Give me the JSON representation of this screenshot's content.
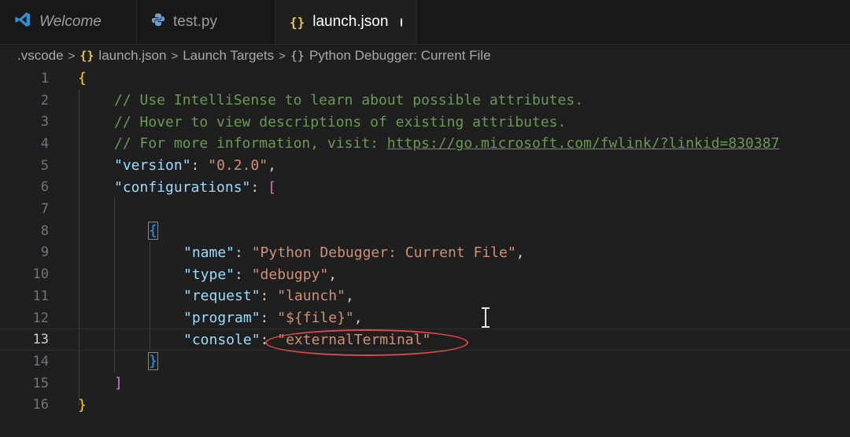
{
  "tabs": [
    {
      "label": "Welcome",
      "icon": "vscode-logo-icon"
    },
    {
      "label": "test.py",
      "icon": "python-icon"
    },
    {
      "label": "launch.json",
      "icon": "json-braces-icon",
      "active": true,
      "dirty": true
    }
  ],
  "breadcrumb": {
    "folder": ".vscode",
    "file_icon": "{}",
    "file": "launch.json",
    "section": "Launch Targets",
    "object_icon": "{}",
    "config": "Python Debugger: Current File"
  },
  "line_numbers": [
    "1",
    "2",
    "3",
    "4",
    "5",
    "6",
    "7",
    "8",
    "9",
    "10",
    "11",
    "12",
    "13",
    "14",
    "15",
    "16"
  ],
  "current_line": 13,
  "code": {
    "open_brace": "{",
    "comment1": "// Use IntelliSense to learn about possible attributes.",
    "comment2": "// Hover to view descriptions of existing attributes.",
    "comment3_prefix": "// For more information, visit: ",
    "comment3_link": "https://go.microsoft.com/fwlink/?linkid=830387",
    "version_key": "\"version\"",
    "version_val": "\"0.2.0\"",
    "configurations_key": "\"configurations\"",
    "open_bracket": "[",
    "inner_open": "{",
    "name_key": "\"name\"",
    "name_val": "\"Python Debugger: Current File\"",
    "type_key": "\"type\"",
    "type_val": "\"debugpy\"",
    "request_key": "\"request\"",
    "request_val": "\"launch\"",
    "program_key": "\"program\"",
    "program_val": "\"${file}\"",
    "console_key": "\"console\"",
    "console_val": "\"externalTerminal\"",
    "inner_close": "}",
    "close_bracket": "]",
    "close_brace": "}"
  },
  "colors": {
    "comment": "#6a9955",
    "key": "#9cdcfe",
    "string": "#ce9178",
    "brace_level1": "#ffd700",
    "bracket_level2": "#da70d6",
    "brace_level3": "#179fff",
    "annotation": "#e04a4a"
  }
}
